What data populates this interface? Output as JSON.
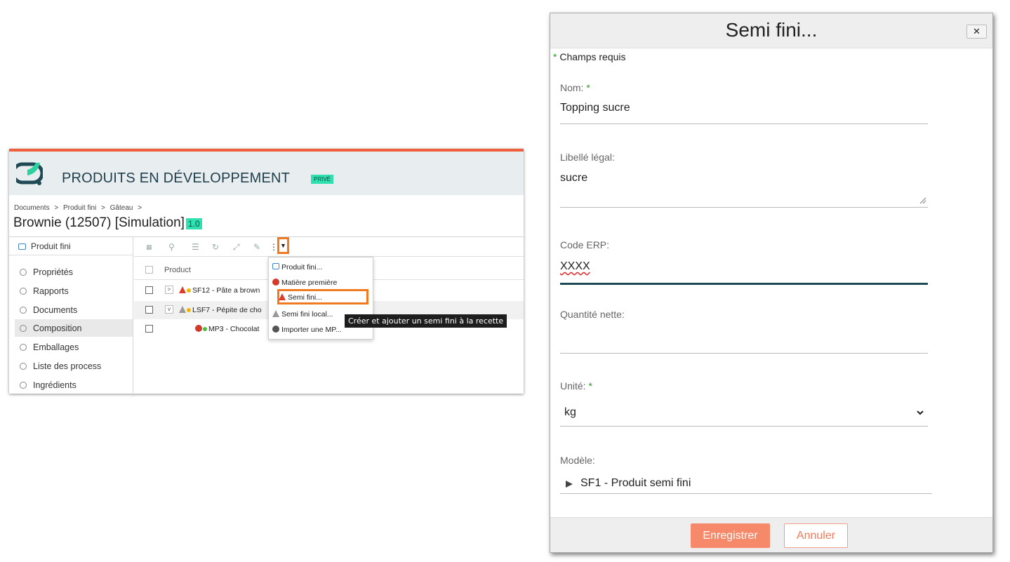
{
  "app": {
    "title": "PRODUITS EN DÉVELOPPEMENT",
    "badge": "PRIVÉ",
    "breadcrumb": [
      "Documents",
      ">",
      "Produit fini",
      ">",
      "Gâteau",
      ">"
    ],
    "doc_title": "Brownie (12507) [Simulation]",
    "version": "1.0"
  },
  "sidebar": {
    "header": "Produit fini",
    "items": [
      "Propriétés",
      "Rapports",
      "Documents",
      "Composition",
      "Emballages",
      "Liste des process",
      "Ingrédients"
    ],
    "active": "Composition"
  },
  "grid": {
    "column_product": "Product",
    "rows": [
      {
        "label": "SF12 - Pâte a brown",
        "expand": ">"
      },
      {
        "label": "LSF7 - Pépite de cho",
        "expand": "v"
      },
      {
        "label": "MP3 - Chocolat",
        "expand": ""
      }
    ]
  },
  "menu": {
    "items": [
      "Produit fini...",
      "Matière première",
      "Semi fini...",
      "Semi fini local...",
      "Importer une MP..."
    ]
  },
  "tooltip": "Créer et ajouter un semi fini à la recette",
  "modal": {
    "title": "Semi fini...",
    "close": "✕",
    "required_note": "Champs requis",
    "star": "*",
    "fields": {
      "nom_label": "Nom:",
      "nom_value": "Topping sucre",
      "libelle_label": "Libellé légal:",
      "libelle_value": "sucre",
      "erp_label": "Code ERP:",
      "erp_value": "XXXX",
      "quantite_label": "Quantité nette:",
      "quantite_value": "",
      "unite_label": "Unité:",
      "unite_value": "kg",
      "modele_label": "Modèle:",
      "modele_value": "SF1 - Produit semi fini"
    },
    "save": "Enregistrer",
    "cancel": "Annuler"
  },
  "colors": {
    "accent": "#ef5f3c",
    "highlight": "#f07a1f",
    "badge": "#2fe0b0",
    "focus_line": "#1f4a55",
    "save_button": "#f5896a"
  }
}
